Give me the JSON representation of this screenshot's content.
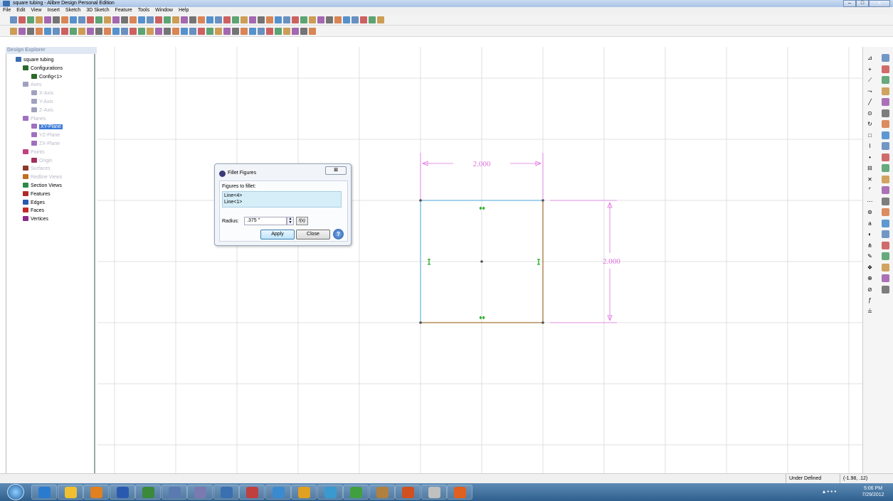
{
  "window": {
    "title": "square tubing - Alibre Design Personal Edition",
    "minimize": "–",
    "maximize": "□",
    "close": "x"
  },
  "menu": [
    "File",
    "Edit",
    "View",
    "Insert",
    "Sketch",
    "3D Sketch",
    "Feature",
    "Tools",
    "Window",
    "Help"
  ],
  "explorer": {
    "header": "Design Explorer",
    "nodes": [
      {
        "label": "square tubing",
        "icon": "part-icon",
        "dim": false
      },
      {
        "label": "Configurations",
        "icon": "configurations-icon",
        "dim": false
      },
      {
        "label": "Config<1>",
        "icon": "config-icon",
        "dim": false
      },
      {
        "label": "Axes",
        "icon": "axes-icon",
        "dim": true
      },
      {
        "label": "X-Axis",
        "icon": "axis-icon",
        "dim": true
      },
      {
        "label": "Y-Axis",
        "icon": "axis-icon",
        "dim": true
      },
      {
        "label": "Z-Axis",
        "icon": "axis-icon",
        "dim": true
      },
      {
        "label": "Planes",
        "icon": "planes-icon",
        "dim": true
      },
      {
        "label": "XY-Plane",
        "icon": "plane-icon",
        "dim": false,
        "selected": true
      },
      {
        "label": "YZ-Plane",
        "icon": "plane-icon",
        "dim": true
      },
      {
        "label": "ZX-Plane",
        "icon": "plane-icon",
        "dim": true
      },
      {
        "label": "Points",
        "icon": "points-icon",
        "dim": true
      },
      {
        "label": "Origin",
        "icon": "origin-icon",
        "dim": true
      },
      {
        "label": "Surfaces",
        "icon": "surfaces-icon",
        "dim": true
      },
      {
        "label": "Redline Views",
        "icon": "redline-icon",
        "dim": true
      },
      {
        "label": "Section Views",
        "icon": "section-icon",
        "dim": false
      },
      {
        "label": "Features",
        "icon": "features-icon",
        "dim": false
      },
      {
        "label": "Edges",
        "icon": "edges-icon",
        "dim": false
      },
      {
        "label": "Faces",
        "icon": "faces-icon",
        "dim": false
      },
      {
        "label": "Vertices",
        "icon": "vertices-icon",
        "dim": false
      }
    ]
  },
  "sketch": {
    "dim_horizontal": "2.000",
    "dim_vertical": "2.000",
    "colors": {
      "grid": "#d8d8d8",
      "left_edge": "#6fb8e0",
      "other_edges": "#a8743a",
      "dimension": "#e070e0",
      "constraint": "#22aa22"
    }
  },
  "dialog": {
    "title": "Fillet Figures",
    "close_label": "⊠",
    "figures_label": "Figures to fillet:",
    "figures": [
      "Line<4>",
      "Line<1>"
    ],
    "radius_label": "Radius:",
    "radius_value": ".375 \"",
    "fx_label": "f(x)",
    "apply_label": "Apply",
    "close_button_label": "Close",
    "help_label": "?"
  },
  "status": {
    "state": "Under Defined",
    "coords": "(-1.98, .12)"
  },
  "taskbar": {
    "time": "5:06 PM",
    "date": "7/29/2012"
  }
}
